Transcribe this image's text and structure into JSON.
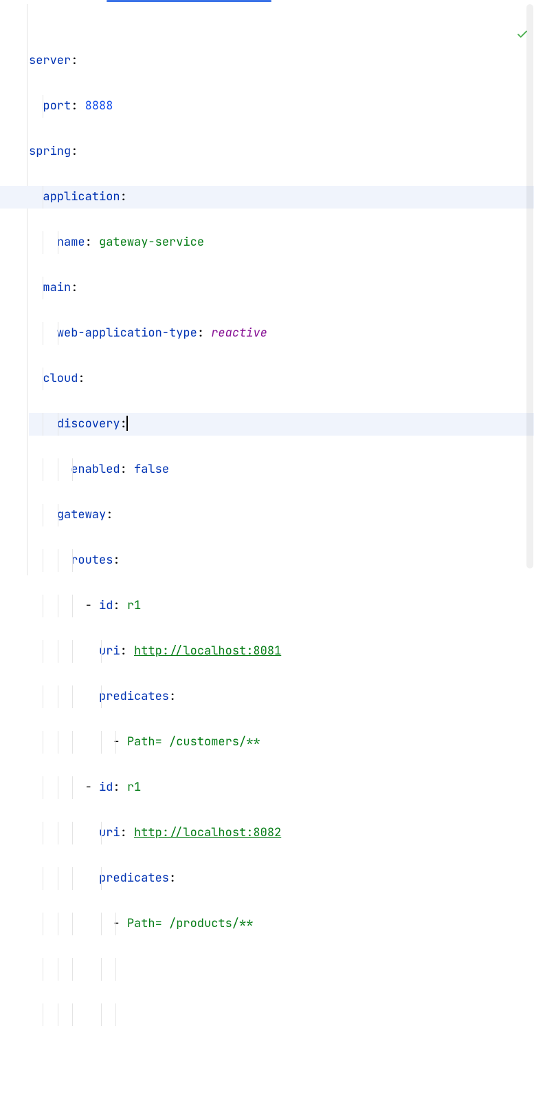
{
  "lines": {
    "l1": {
      "k": "server",
      "c": ":"
    },
    "l2": {
      "k": "port",
      "c": ": ",
      "v": "8888"
    },
    "l3": {
      "k": "spring",
      "c": ":"
    },
    "l4": {
      "k": "application",
      "c": ":"
    },
    "l5": {
      "k": "name",
      "c": ": ",
      "v": "gateway-service"
    },
    "l6": {
      "k": "main",
      "c": ":"
    },
    "l7": {
      "k": "web-application-type",
      "c": ": ",
      "v": "reactive"
    },
    "l8": {
      "k": "cloud",
      "c": ":"
    },
    "l9": {
      "k": "discovery",
      "c": ":"
    },
    "l10": {
      "k": "enabled",
      "c": ": ",
      "v": "false"
    },
    "l11": {
      "k": "gateway",
      "c": ":"
    },
    "l12": {
      "k": "routes",
      "c": ":"
    },
    "l13": {
      "d": "- ",
      "k": "id",
      "c": ": ",
      "v": "r1"
    },
    "l14": {
      "k": "uri",
      "c": ": ",
      "v": "http://localhost:8081"
    },
    "l15": {
      "k": "predicates",
      "c": ":"
    },
    "l16": {
      "d": "- ",
      "v": "Path= /customers/**"
    },
    "l17": {
      "d": "- ",
      "k": "id",
      "c": ": ",
      "v": "r1"
    },
    "l18": {
      "k": "uri",
      "c": ": ",
      "v": "http://localhost:8082"
    },
    "l19": {
      "k": "predicates",
      "c": ":"
    },
    "l20": {
      "d": "- ",
      "v": "Path= /products/**"
    }
  },
  "indent": {
    "i2": "  ",
    "i4": "    ",
    "i6": "      ",
    "i8": "        ",
    "i10": "          ",
    "i12": "            "
  }
}
